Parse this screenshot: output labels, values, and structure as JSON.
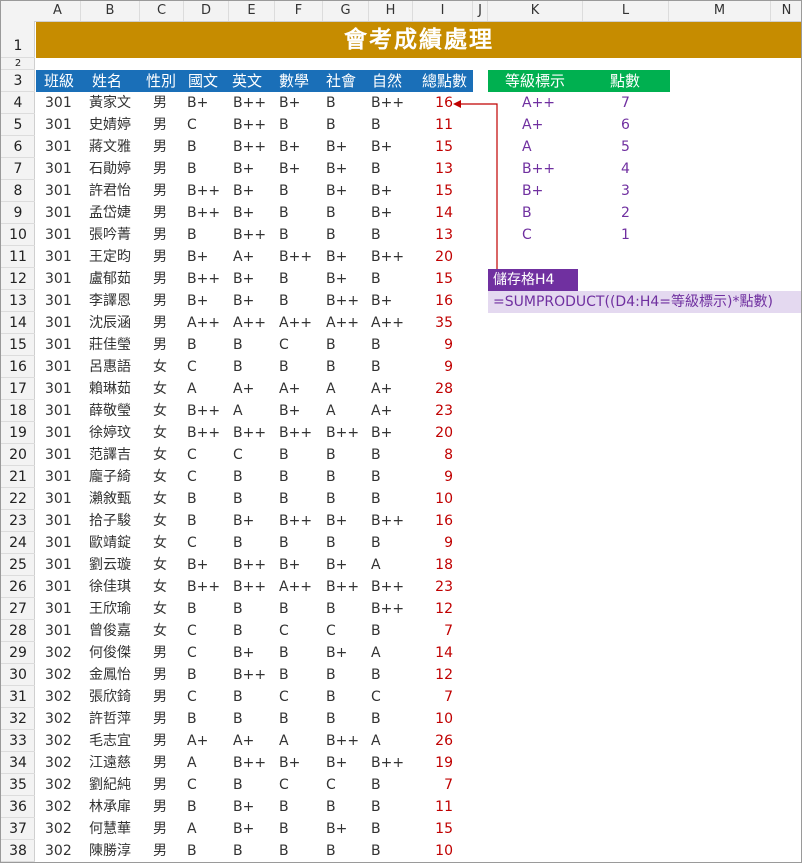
{
  "columns": [
    "A",
    "B",
    "C",
    "D",
    "E",
    "F",
    "G",
    "H",
    "I",
    "J",
    "K",
    "L",
    "M",
    "N"
  ],
  "title": "會考成績處理",
  "headers": [
    "班級",
    "姓名",
    "性別",
    "國文",
    "英文",
    "數學",
    "社會",
    "自然",
    "總點數"
  ],
  "rows": [
    [
      "301",
      "黃家文",
      "男",
      "B+",
      "B++",
      "B+",
      "B",
      "B++",
      "16"
    ],
    [
      "301",
      "史婧婷",
      "男",
      "C",
      "B++",
      "B",
      "B",
      "B",
      "11"
    ],
    [
      "301",
      "蔣文雅",
      "男",
      "B",
      "B++",
      "B+",
      "B+",
      "B+",
      "15"
    ],
    [
      "301",
      "石勛婷",
      "男",
      "B",
      "B+",
      "B+",
      "B+",
      "B",
      "13"
    ],
    [
      "301",
      "許君怡",
      "男",
      "B++",
      "B+",
      "B",
      "B+",
      "B+",
      "15"
    ],
    [
      "301",
      "孟岱婕",
      "男",
      "B++",
      "B+",
      "B",
      "B",
      "B+",
      "14"
    ],
    [
      "301",
      "張吟菁",
      "男",
      "B",
      "B++",
      "B",
      "B",
      "B",
      "13"
    ],
    [
      "301",
      "王定昀",
      "男",
      "B+",
      "A+",
      "B++",
      "B+",
      "B++",
      "20"
    ],
    [
      "301",
      "盧郁茹",
      "男",
      "B++",
      "B+",
      "B",
      "B+",
      "B",
      "15"
    ],
    [
      "301",
      "李譯恩",
      "男",
      "B+",
      "B+",
      "B",
      "B++",
      "B+",
      "16"
    ],
    [
      "301",
      "沈辰涵",
      "男",
      "A++",
      "A++",
      "A++",
      "A++",
      "A++",
      "35"
    ],
    [
      "301",
      "莊佳瑩",
      "男",
      "B",
      "B",
      "C",
      "B",
      "B",
      "9"
    ],
    [
      "301",
      "呂惠語",
      "女",
      "C",
      "B",
      "B",
      "B",
      "B",
      "9"
    ],
    [
      "301",
      "賴琳茹",
      "女",
      "A",
      "A+",
      "A+",
      "A",
      "A+",
      "28"
    ],
    [
      "301",
      "薛敬瑩",
      "女",
      "B++",
      "A",
      "B+",
      "A",
      "A+",
      "23"
    ],
    [
      "301",
      "徐婷玟",
      "女",
      "B++",
      "B++",
      "B++",
      "B++",
      "B+",
      "20"
    ],
    [
      "301",
      "范譯吉",
      "女",
      "C",
      "C",
      "B",
      "B",
      "B",
      "8"
    ],
    [
      "301",
      "龐子綺",
      "女",
      "C",
      "B",
      "B",
      "B",
      "B",
      "9"
    ],
    [
      "301",
      "瀨敘甄",
      "女",
      "B",
      "B",
      "B",
      "B",
      "B",
      "10"
    ],
    [
      "301",
      "拾子駿",
      "女",
      "B",
      "B+",
      "B++",
      "B+",
      "B++",
      "16"
    ],
    [
      "301",
      "歐靖錠",
      "女",
      "C",
      "B",
      "B",
      "B",
      "B",
      "9"
    ],
    [
      "301",
      "劉云璇",
      "女",
      "B+",
      "B++",
      "B+",
      "B+",
      "A",
      "18"
    ],
    [
      "301",
      "徐佳琪",
      "女",
      "B++",
      "B++",
      "A++",
      "B++",
      "B++",
      "23"
    ],
    [
      "301",
      "王欣瑜",
      "女",
      "B",
      "B",
      "B",
      "B",
      "B++",
      "12"
    ],
    [
      "301",
      "曾俊嘉",
      "女",
      "C",
      "B",
      "C",
      "C",
      "B",
      "7"
    ],
    [
      "302",
      "何俊傑",
      "男",
      "C",
      "B+",
      "B",
      "B+",
      "A",
      "14"
    ],
    [
      "302",
      "金鳳怡",
      "男",
      "B",
      "B++",
      "B",
      "B",
      "B",
      "12"
    ],
    [
      "302",
      "張欣錡",
      "男",
      "C",
      "B",
      "C",
      "B",
      "C",
      "7"
    ],
    [
      "302",
      "許哲萍",
      "男",
      "B",
      "B",
      "B",
      "B",
      "B",
      "10"
    ],
    [
      "302",
      "毛志宜",
      "男",
      "A+",
      "A+",
      "A",
      "B++",
      "A",
      "26"
    ],
    [
      "302",
      "江遠慈",
      "男",
      "A",
      "B++",
      "B+",
      "B+",
      "B++",
      "19"
    ],
    [
      "302",
      "劉紀純",
      "男",
      "C",
      "B",
      "C",
      "C",
      "B",
      "7"
    ],
    [
      "302",
      "林承扉",
      "男",
      "B",
      "B+",
      "B",
      "B",
      "B",
      "11"
    ],
    [
      "302",
      "何慧華",
      "男",
      "A",
      "B+",
      "B",
      "B+",
      "B",
      "15"
    ],
    [
      "302",
      "陳勝淳",
      "男",
      "B",
      "B",
      "B",
      "B",
      "B",
      "10"
    ]
  ],
  "grade_table": {
    "headers": [
      "等級標示",
      "點數"
    ],
    "rows": [
      [
        "A++",
        "7"
      ],
      [
        "A+",
        "6"
      ],
      [
        "A",
        "5"
      ],
      [
        "B++",
        "4"
      ],
      [
        "B+",
        "3"
      ],
      [
        "B",
        "2"
      ],
      [
        "C",
        "1"
      ]
    ]
  },
  "annotation": {
    "label": "儲存格H4",
    "formula": "=SUMPRODUCT((D4:H4=等級標示)*點數)"
  },
  "colors": {
    "title_bg": "#c68c00",
    "header_bg": "#1a6fb8",
    "grade_header_bg": "#00b050",
    "accent_purple": "#7030a0",
    "points_red": "#c00000"
  }
}
